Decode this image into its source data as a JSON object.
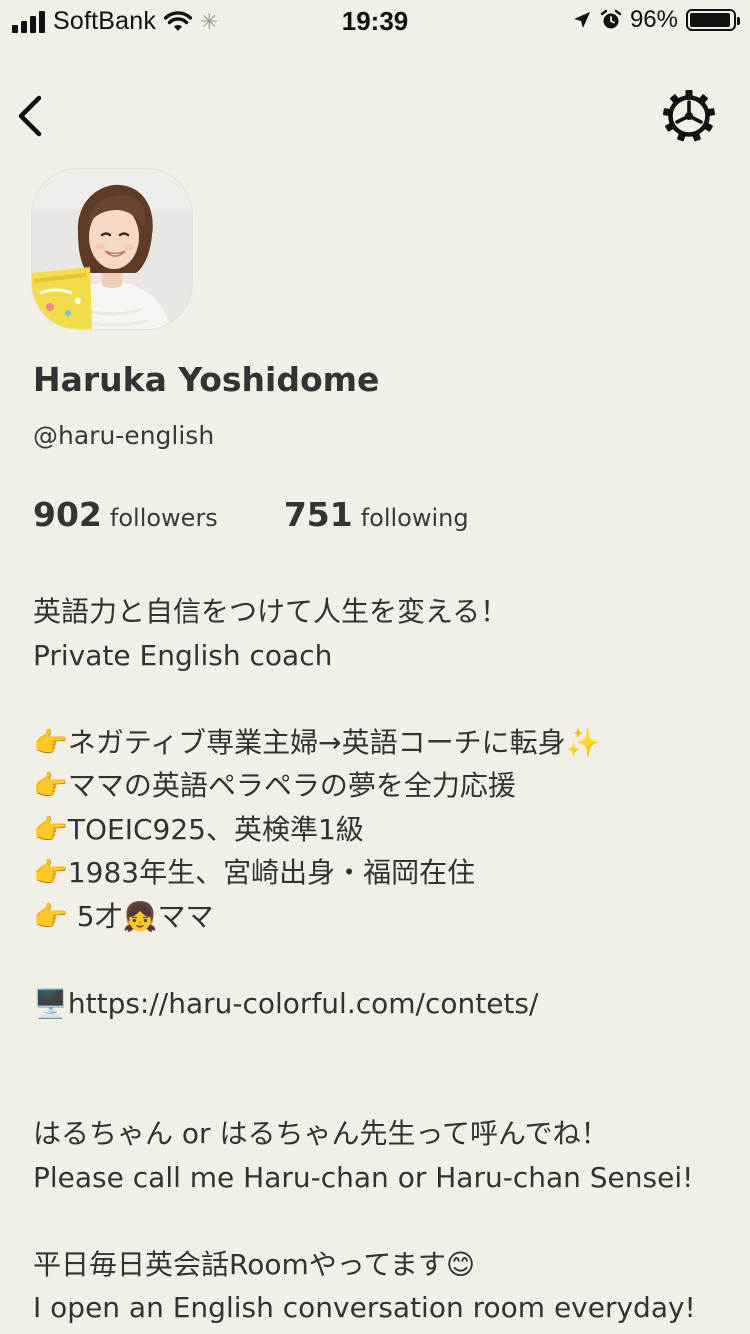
{
  "status_bar": {
    "carrier": "SoftBank",
    "time": "19:39",
    "battery_percent": "96%",
    "battery_level": 0.96
  },
  "nav": {
    "back_icon": "chevron-left-icon",
    "settings_icon": "gear-icon"
  },
  "profile": {
    "name": "Haruka Yoshidome",
    "handle": "@haru-english",
    "followers_count": "902",
    "followers_label": "followers",
    "following_count": "751",
    "following_label": "following"
  },
  "bio": {
    "lines": [
      "英語力と自信をつけて人生を変える！",
      "Private English coach",
      "",
      "👉ネガティブ専業主婦→英語コーチに転身✨",
      "👉ママの英語ペラペラの夢を全力応援",
      "👉TOEIC925、英検準1級",
      "👉1983年生、宮崎出身・福岡在住",
      "👉 5才👧ママ",
      "",
      "🖥️https://haru-colorful.com/contets/",
      "",
      "",
      "はるちゃん or はるちゃん先生って呼んでね！",
      "Please call me Haru-chan or Haru-chan Sensei!",
      "",
      "平日毎日英会話Roomやってます😊",
      "I open an English conversation room everyday!"
    ]
  },
  "colors": {
    "background": "#f1efe6",
    "text": "#333333"
  }
}
